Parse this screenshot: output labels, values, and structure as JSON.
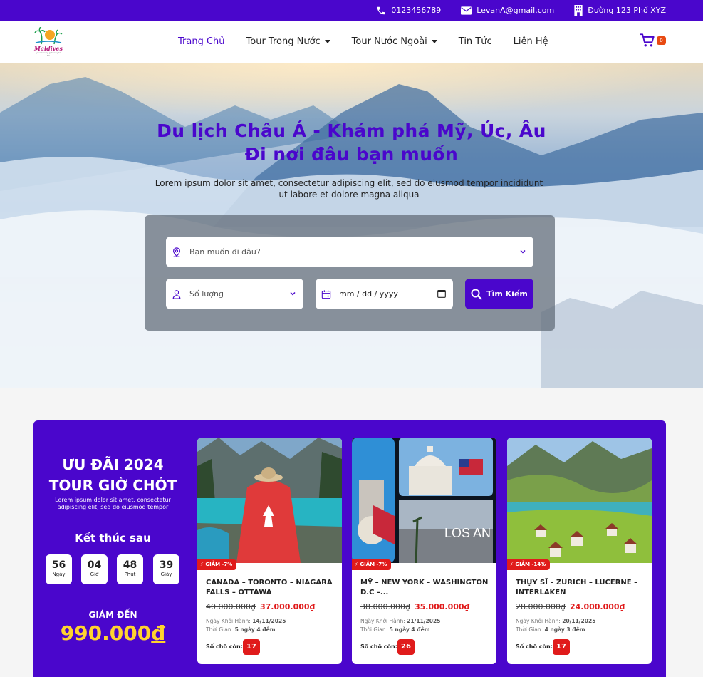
{
  "topbar": {
    "phone": "0123456789",
    "email": "LevanA@gmail.com",
    "address": "Đường 123 Phố XYZ"
  },
  "nav": {
    "logo_text": "Maldives",
    "logo_sub": "your luxury getaway to life",
    "items": [
      {
        "label": "Trang Chủ",
        "active": true,
        "dropdown": false
      },
      {
        "label": "Tour Trong Nước",
        "active": false,
        "dropdown": true
      },
      {
        "label": "Tour Nước Ngoài",
        "active": false,
        "dropdown": true
      },
      {
        "label": "Tin Tức",
        "active": false,
        "dropdown": false
      },
      {
        "label": "Liên Hệ",
        "active": false,
        "dropdown": false
      }
    ],
    "cart_count": "0"
  },
  "hero": {
    "title_line1": "Du lịch Châu Á - Khám phá Mỹ, Úc, Âu",
    "title_line2": "Đi nơi đâu bạn muốn",
    "subtitle": "Lorem ipsum dolor sit amet, consectetur adipiscing elit, sed do eiusmod tempor incididunt ut labore et dolore magna aliqua"
  },
  "search": {
    "destination_placeholder": "Bạn muốn đi đâu?",
    "quantity_placeholder": "Số lượng",
    "date_value": "mm / dd / yyyy",
    "button_label": "Tìm Kiếm"
  },
  "promo": {
    "title_line1": "ƯU ĐÃI 2024",
    "title_line2": "TOUR GIỜ CHÓT",
    "subtitle": "Lorem ipsum dolor sit amet, consectetur adipiscing elit, sed do eiusmod tempor",
    "ends_label": "Kết thúc sau",
    "countdown": [
      {
        "value": "56",
        "unit": "Ngày"
      },
      {
        "value": "04",
        "unit": "Giờ"
      },
      {
        "value": "48",
        "unit": "Phút"
      },
      {
        "value": "39",
        "unit": "Giây"
      }
    ],
    "upto_label": "GIẢM ĐẾN",
    "upto_value": "990.000",
    "upto_currency": "đ"
  },
  "tours": [
    {
      "badge": "⚡ GIẢM -7%",
      "name": "CANADA – TORONTO – NIAGARA FALLS – OTTAWA",
      "old_price": "40.000.000₫",
      "new_price": "37.000.000₫",
      "departure_label": "Ngày Khởi Hành:",
      "departure": "14/11/2025",
      "duration_label": "Thời Gian:",
      "duration": "5 ngày 4 đêm",
      "seats_label": "Số chỗ còn:",
      "seats": "17",
      "image": "canada-lake"
    },
    {
      "badge": "⚡ GIẢM -7%",
      "name": "MỸ – NEW YORK – WASHINGTON D.C –...",
      "old_price": "38.000.000₫",
      "new_price": "35.000.000₫",
      "departure_label": "Ngày Khởi Hành:",
      "departure": "21/11/2025",
      "duration_label": "Thời Gian:",
      "duration": "5 ngày 4 đêm",
      "seats_label": "Số chỗ còn:",
      "seats": "26",
      "image": "usa-collage",
      "image_text": "LOS AN"
    },
    {
      "badge": "⚡ GIẢM -14%",
      "name": "THỤY SĨ – ZURICH – LUCERNE – INTERLAKEN",
      "old_price": "28.000.000₫",
      "new_price": "24.000.000₫",
      "departure_label": "Ngày Khởi Hành:",
      "departure": "20/11/2025",
      "duration_label": "Thời Gian:",
      "duration": "4 ngày 3 đêm",
      "seats_label": "Số chỗ còn:",
      "seats": "17",
      "image": "swiss-valley"
    }
  ],
  "colors": {
    "brand": "#4a06cc",
    "accent_red": "#e01b1b",
    "gold": "#ffd32e"
  }
}
